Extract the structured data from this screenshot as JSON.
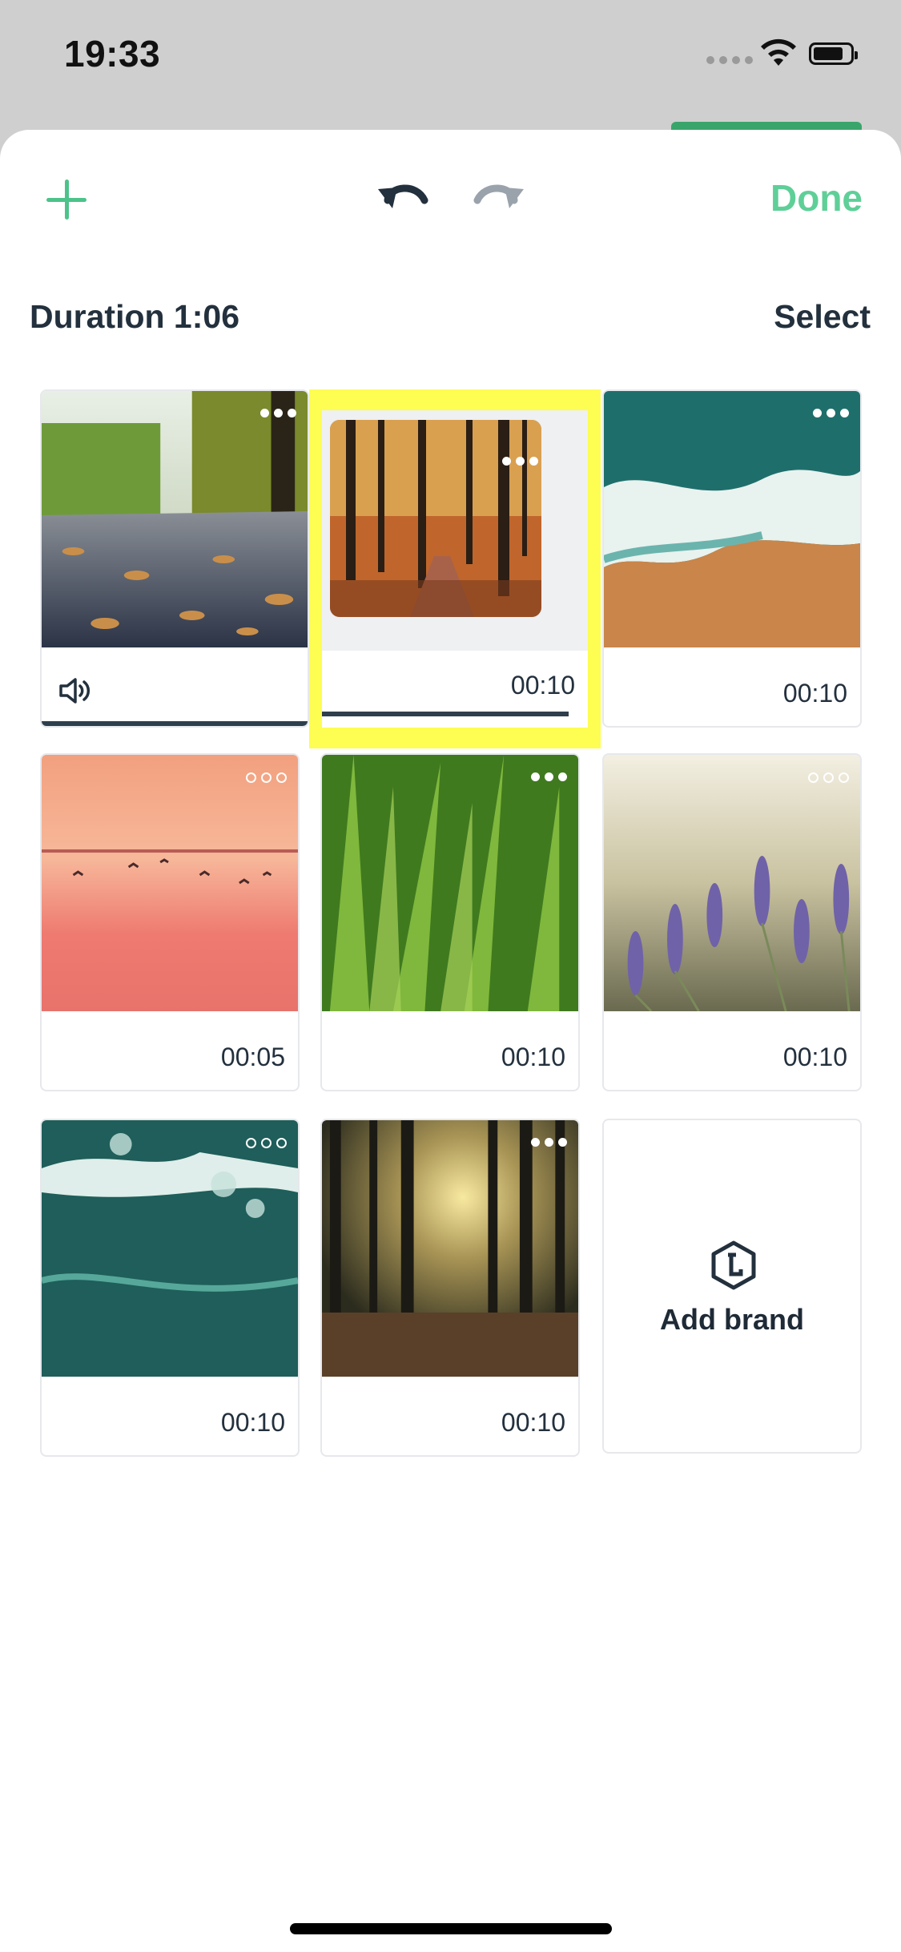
{
  "status_bar": {
    "time": "19:33"
  },
  "header": {
    "done_label": "Done"
  },
  "subheader": {
    "duration_label": "Duration 1:06",
    "select_label": "Select"
  },
  "clips": [
    {
      "duration": "",
      "scene": "autumn road with leaves"
    },
    {
      "duration": "00:10",
      "scene": "autumn forest path",
      "selected": true
    },
    {
      "duration": "00:10",
      "scene": "ocean waves on sand"
    },
    {
      "duration": "00:05",
      "scene": "pink sunset over water with birds"
    },
    {
      "duration": "00:10",
      "scene": "green grass blades"
    },
    {
      "duration": "00:10",
      "scene": "lavender field"
    },
    {
      "duration": "00:10",
      "scene": "teal ocean wave"
    },
    {
      "duration": "00:10",
      "scene": "sunlit forest"
    }
  ],
  "add_brand": {
    "label": "Add brand"
  },
  "colors": {
    "accent": "#5fcf98",
    "plus": "#4cc38a",
    "highlight": "#fdfd52",
    "text": "#23303d"
  }
}
